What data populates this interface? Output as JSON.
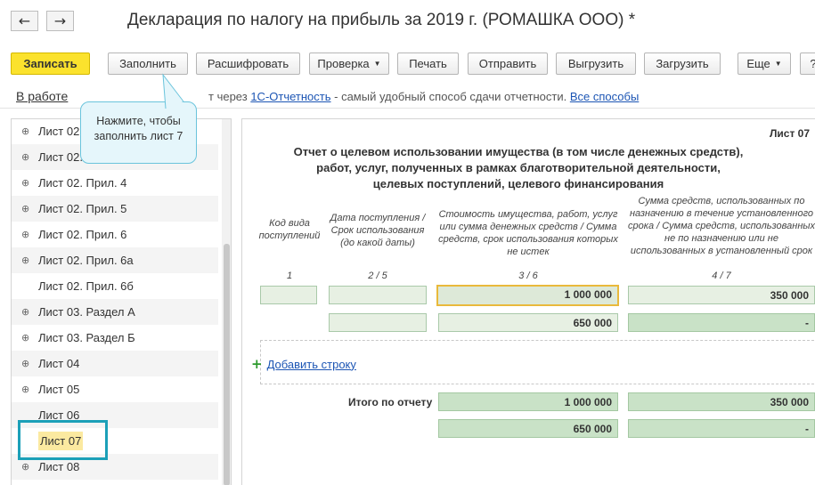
{
  "window": {
    "title": "Декларация по налогу на прибыль за 2019 г. (РОМАШКА ООО) *",
    "back_icon": "←",
    "forward_icon": "→"
  },
  "toolbar": {
    "save": "Записать",
    "fill": "Заполнить",
    "decode": "Расшифровать",
    "check": "Проверка",
    "print": "Печать",
    "send": "Отправить",
    "export": "Выгрузить",
    "import": "Загрузить",
    "more": "Еще",
    "help": "?"
  },
  "info": {
    "status": "В работе",
    "text_prefix": "т через ",
    "service_link": "1С-Отчетность",
    "text_suffix": " - самый удобный способ сдачи отчетности. ",
    "all_methods_link": "Все способы"
  },
  "tooltip": {
    "text_line1": "Нажмите, чтобы",
    "text_line2": "заполнить лист 7"
  },
  "sidebar": {
    "items": [
      {
        "label": "Лист 02.",
        "plus": true
      },
      {
        "label": "Лист 02.",
        "plus": true
      },
      {
        "label": "Лист 02. Прил. 4",
        "plus": true
      },
      {
        "label": "Лист 02. Прил. 5",
        "plus": true
      },
      {
        "label": "Лист 02. Прил. 6",
        "plus": true
      },
      {
        "label": "Лист 02. Прил. 6а",
        "plus": true
      },
      {
        "label": "Лист 02. Прил. 6б",
        "plus": false
      },
      {
        "label": "Лист 03. Раздел А",
        "plus": true
      },
      {
        "label": "Лист 03. Раздел Б",
        "plus": true
      },
      {
        "label": "Лист 04",
        "plus": true
      },
      {
        "label": "Лист 05",
        "plus": true
      },
      {
        "label": "Лист 06",
        "plus": false
      },
      {
        "label": "Лист 07",
        "plus": false,
        "selected": true
      },
      {
        "label": "Лист 08",
        "plus": true
      }
    ]
  },
  "form": {
    "sheet_label": "Лист 07",
    "title_line1": "Отчет о целевом использовании имущества (в том числе денежных средств),",
    "title_line2": "работ, услуг, полученных в рамках благотворительной деятельности,",
    "title_line3": "целевых поступлений, целевого финансирования",
    "columns": [
      {
        "header": "Код вида поступлений",
        "num": "1"
      },
      {
        "header": "Дата поступления / Срок использования (до какой даты)",
        "num": "2 / 5"
      },
      {
        "header": "Стоимость имущества, работ, услуг или сумма денежных средств / Сумма средств, срок использования которых не истек",
        "num": "3 / 6"
      },
      {
        "header": "Сумма средств, использованных по назначению в течение установленного срока / Сумма средств, использованных не по назначению или не использованных в установленный срок",
        "num": "4 / 7"
      }
    ],
    "row1": {
      "col1": "",
      "col2": "",
      "col3": "1 000 000",
      "col4": "350 000"
    },
    "row2": {
      "col2": "",
      "col3": "650 000",
      "col4": "-"
    },
    "add_row": "Добавить строку",
    "total_label": "Итого по отчету",
    "total1": {
      "col3": "1 000 000",
      "col4": "350 000"
    },
    "total2": {
      "col3": "650 000",
      "col4": "-"
    }
  }
}
